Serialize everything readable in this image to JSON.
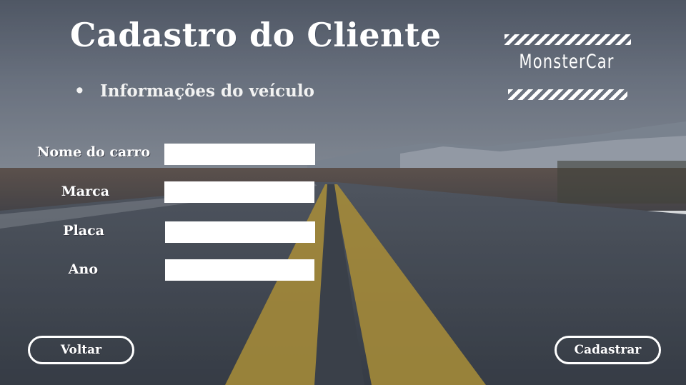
{
  "page": {
    "title": "Cadastro do Cliente",
    "subtitle_bullet": "•",
    "subtitle": "Informações do veículo"
  },
  "logo": {
    "text": "MonsterCar"
  },
  "form": {
    "fields": [
      {
        "label": "Nome do carro",
        "value": "",
        "placeholder": ""
      },
      {
        "label": "Marca",
        "value": "",
        "placeholder": ""
      },
      {
        "label": "Placa",
        "value": "",
        "placeholder": ""
      },
      {
        "label": "Ano",
        "value": "",
        "placeholder": ""
      }
    ]
  },
  "buttons": {
    "back_label": "Voltar",
    "submit_label": "Cadastrar"
  },
  "colors": {
    "text": "#ffffff",
    "field_background": "#ffffff",
    "road_line": "#c9a43a",
    "sky": "#6d7583",
    "asphalt": "#4a4f58"
  }
}
